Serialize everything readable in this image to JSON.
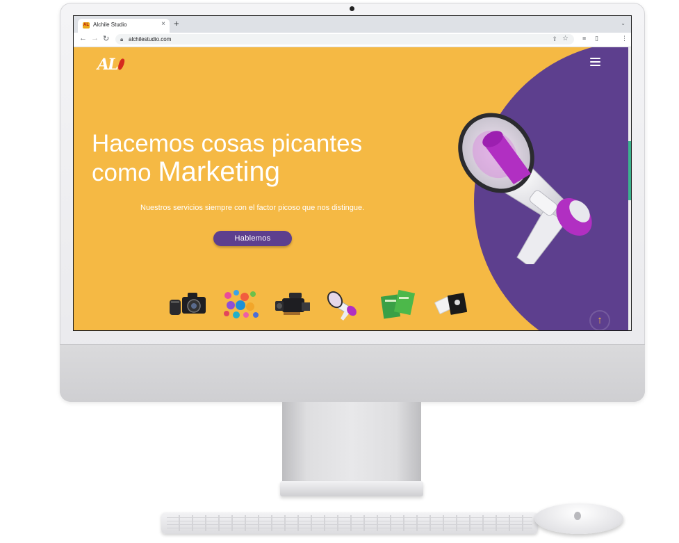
{
  "browser": {
    "tab_title": "Alchile Studio",
    "tab_close": "×",
    "new_tab": "+",
    "tab_menu": "⌄",
    "url": "alchilestudio.com",
    "back": "←",
    "forward": "→",
    "reload": "↻",
    "lock_icon": "lock-icon",
    "share_icon": "share-icon",
    "star_icon": "star-icon"
  },
  "site": {
    "logo_text": "AL",
    "headline_line1": "Hacemos cosas picantes",
    "headline_line2_prefix": "como ",
    "headline_line2_highlight": "Marketing",
    "subtitle": "Nuestros servicios siempre con el factor picoso que nos distingue.",
    "cta_label": "Hablemos",
    "scroll_top": "↑",
    "services": [
      "camera-icon",
      "social-media-icon",
      "video-camera-icon",
      "megaphone-icon",
      "print-icon",
      "business-cards-icon"
    ]
  },
  "colors": {
    "background": "#f5b944",
    "accent": "#5d3f8e",
    "text": "#ffffff",
    "highlight": "#b12fc2"
  }
}
